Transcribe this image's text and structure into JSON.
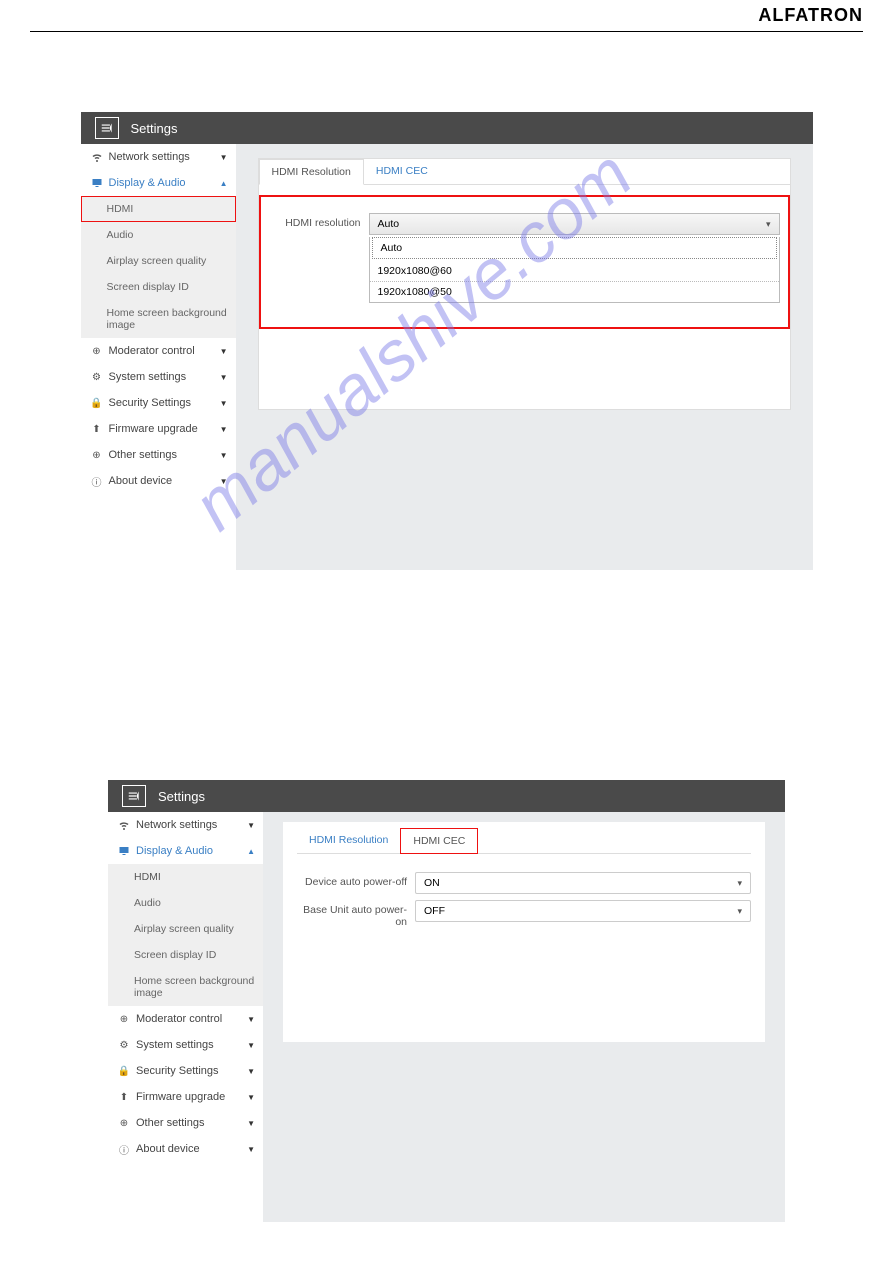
{
  "brand": "ALFATRON",
  "watermark": "manualshive.com",
  "panel1": {
    "header": "Settings",
    "side": {
      "network": "Network settings",
      "display": "Display & Audio",
      "sub": {
        "hdmi": "HDMI",
        "audio": "Audio",
        "airplay": "Airplay screen quality",
        "sdid": "Screen display ID",
        "homebg": "Home screen background image"
      },
      "mod": "Moderator control",
      "sys": "System settings",
      "sec": "Security Settings",
      "fw": "Firmware upgrade",
      "other": "Other settings",
      "about": "About device"
    },
    "tabs": {
      "res": "HDMI Resolution",
      "cec": "HDMI CEC"
    },
    "form": {
      "label": "HDMI resolution",
      "value": "Auto",
      "opts": {
        "o1": "Auto",
        "o2": "1920x1080@60",
        "o3": "1920x1080@50"
      }
    }
  },
  "panel2": {
    "header": "Settings",
    "side": {
      "network": "Network settings",
      "display": "Display & Audio",
      "sub": {
        "hdmi": "HDMI",
        "audio": "Audio",
        "airplay": "Airplay screen quality",
        "sdid": "Screen display ID",
        "homebg": "Home screen background image"
      },
      "mod": "Moderator control",
      "sys": "System settings",
      "sec": "Security Settings",
      "fw": "Firmware upgrade",
      "other": "Other settings",
      "about": "About device"
    },
    "tabs": {
      "res": "HDMI Resolution",
      "cec": "HDMI CEC"
    },
    "form": {
      "row1label": "Device auto power-off",
      "row1value": "ON",
      "row2label": "Base Unit auto power-on",
      "row2value": "OFF"
    }
  }
}
